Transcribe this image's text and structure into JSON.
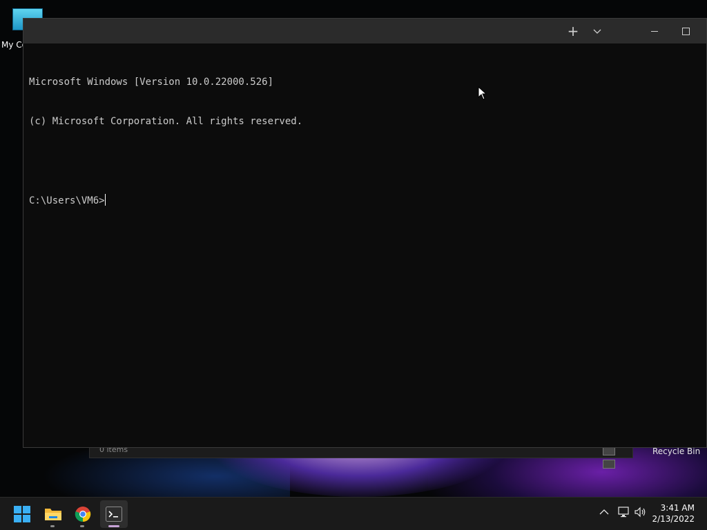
{
  "desktop": {
    "icon_my_computer_label": "My Co",
    "recycle_bin_label": "Recycle Bin",
    "explorer_status_count": "0 items"
  },
  "terminal": {
    "new_tab_label": "+",
    "lines": [
      "Microsoft Windows [Version 10.0.22000.526]",
      "(c) Microsoft Corporation. All rights reserved.",
      "",
      "C:\\Users\\VM6>"
    ]
  },
  "taskbar": {
    "apps": [
      {
        "name": "start",
        "icon": "windows-logo-icon"
      },
      {
        "name": "file-explorer",
        "icon": "folder-icon"
      },
      {
        "name": "chrome",
        "icon": "chrome-icon"
      },
      {
        "name": "terminal",
        "icon": "terminal-icon",
        "active": true
      }
    ],
    "tray": {
      "time": "3:41 AM",
      "date": "2/13/2022"
    }
  },
  "colors": {
    "terminal_bg": "#0c0c0c",
    "titlebar_bg": "#2b2b2b",
    "text": "#cccccc",
    "taskbar_bg": "#1a1a1a"
  }
}
